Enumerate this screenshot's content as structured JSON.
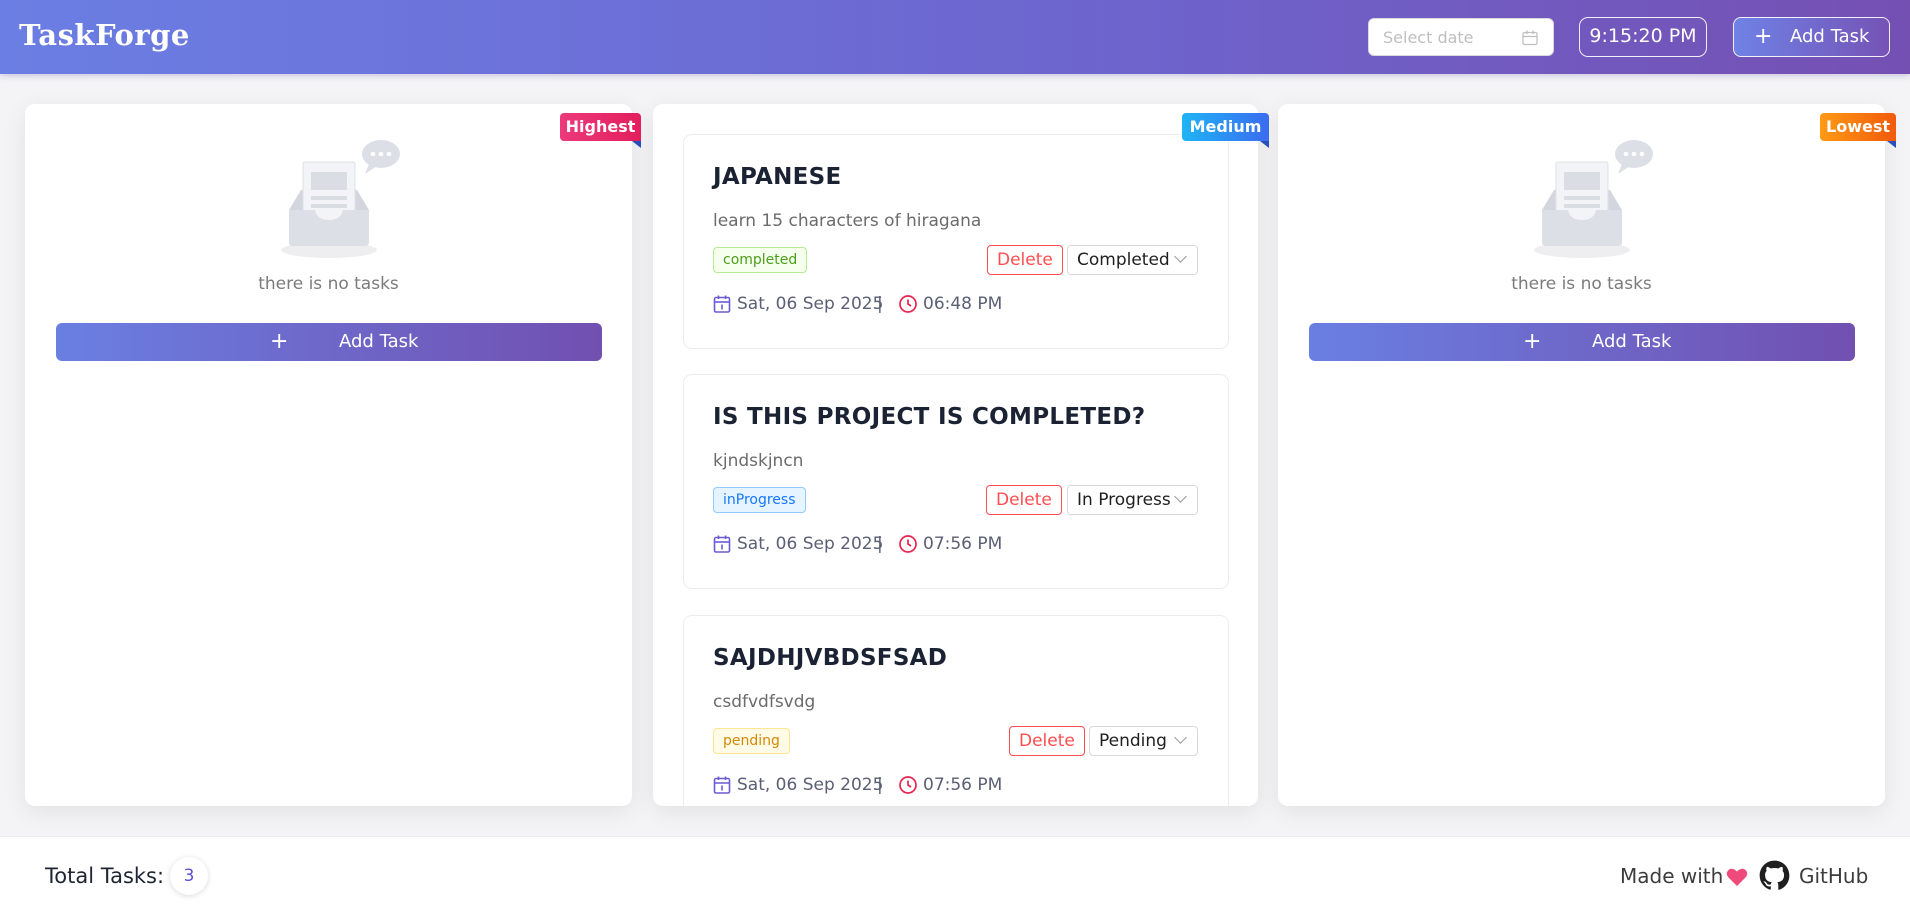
{
  "header": {
    "logo": "TaskForge",
    "date_placeholder": "Select date",
    "clock": "9:15:20 PM",
    "add_task_label": "Add Task"
  },
  "columns": {
    "highest": {
      "ribbon": "Highest",
      "empty_message": "there is no tasks",
      "add_task_label": "Add Task"
    },
    "medium": {
      "ribbon": "Medium",
      "tasks": [
        {
          "title": "JAPANESE",
          "description": "learn 15 characters of hiragana",
          "tag": "completed",
          "delete_label": "Delete",
          "status": "Completed",
          "date": "Sat, 06 Sep 2025",
          "separator": "|",
          "time": "06:48 PM"
        },
        {
          "title": "IS THIS PROJECT IS COMPLETED?",
          "description": "kjndskjncn",
          "tag": "inProgress",
          "delete_label": "Delete",
          "status": "In Progress",
          "date": "Sat, 06 Sep 2025",
          "separator": "|",
          "time": "07:56 PM"
        },
        {
          "title": "SAJDHJVBDSFSAD",
          "description": "csdfvdfsvdg",
          "tag": "pending",
          "delete_label": "Delete",
          "status": "Pending",
          "date": "Sat, 06 Sep 2025",
          "separator": "|",
          "time": "07:56 PM"
        }
      ]
    },
    "lowest": {
      "ribbon": "Lowest",
      "empty_message": "there is no tasks",
      "add_task_label": "Add Task"
    }
  },
  "footer": {
    "total_label": "Total Tasks:",
    "total_count": "3",
    "made_with": "Made with",
    "github_label": "GitHub"
  },
  "colors": {
    "header_gradient_start": "#6b7ee3",
    "header_gradient_end": "#7550b3",
    "ribbon_highest": "#e31e5c",
    "ribbon_medium": "#3a6cf0",
    "ribbon_lowest": "#f15a0a",
    "delete": "#ff4d4f"
  },
  "icons": {
    "calendar": "calendar-icon",
    "clock": "clock-icon",
    "plus": "plus-icon",
    "heart": "heart-icon",
    "github": "github-icon",
    "empty": "empty-inbox-icon"
  }
}
